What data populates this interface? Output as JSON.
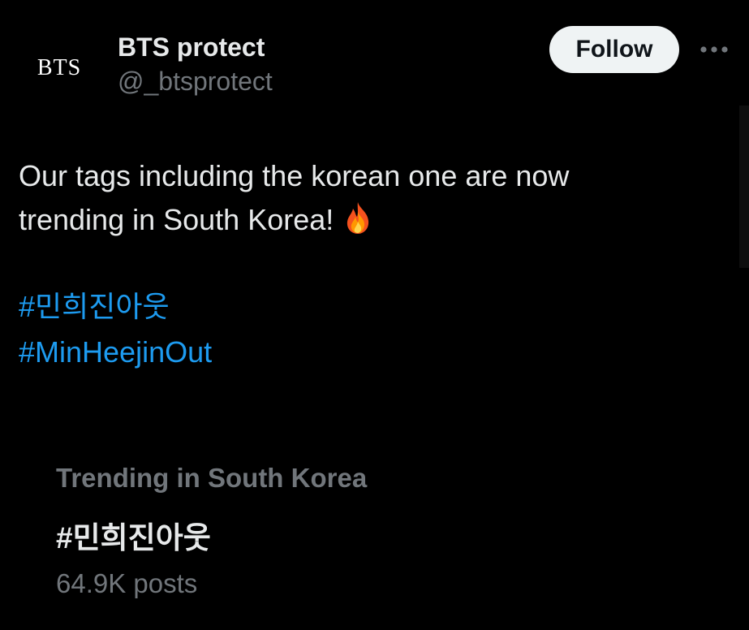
{
  "account": {
    "avatar_text": "BTS",
    "display_name": "BTS protect",
    "handle": "@_btsprotect"
  },
  "actions": {
    "follow_label": "Follow",
    "more_icon": "more-horizontal-icon"
  },
  "tweet": {
    "line1": "Our tags including the korean one are now",
    "line2": "trending in South Korea!",
    "emoji_icon": "fire-icon",
    "hashtags": [
      "#민희진아웃",
      "#MinHeejinOut"
    ]
  },
  "trend": {
    "context": "Trending in South Korea",
    "name": "#민희진아웃",
    "post_count": "64.9K posts"
  },
  "colors": {
    "background": "#000000",
    "text_primary": "#e7e9ea",
    "text_secondary": "#71767b",
    "link": "#1d9bf0",
    "follow_bg": "#eff3f4"
  }
}
